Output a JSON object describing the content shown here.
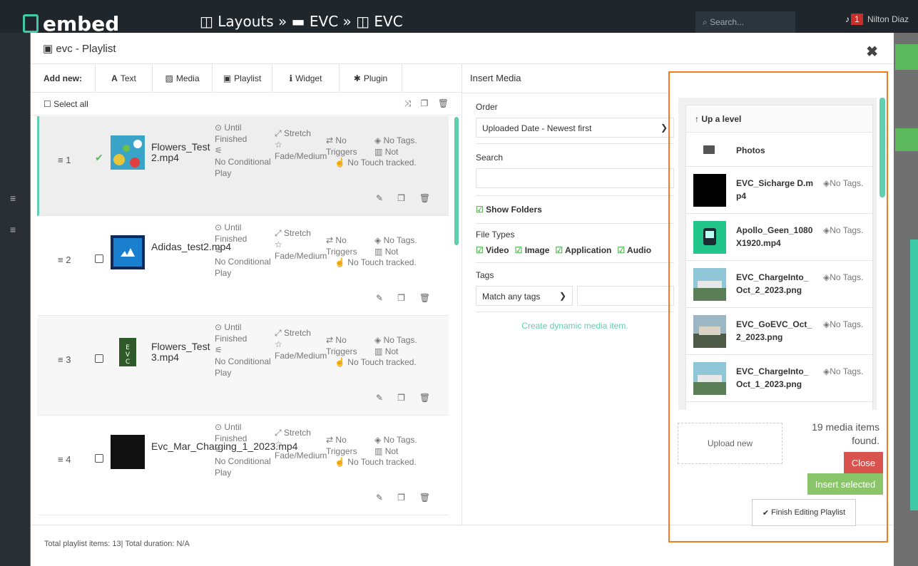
{
  "app": {
    "logo": "embed",
    "breadcrumb": [
      "Layouts",
      "EVC",
      "EVC"
    ],
    "search_placeholder": "Search...",
    "notification_count": "1",
    "user": "Nilton Diaz"
  },
  "modal": {
    "title": "evc - Playlist",
    "close_glyph": "✖"
  },
  "add_new": {
    "label": "Add new:",
    "buttons": [
      "Text",
      "Media",
      "Playlist",
      "Widget",
      "Plugin"
    ]
  },
  "toolbar": {
    "select_all": "Select all"
  },
  "playlist": [
    {
      "index": "1",
      "name": "Flowers_Test 2.mp4",
      "checked": true,
      "duration": "Until Finished",
      "condition": "No Conditional Play",
      "stretch": "Stretch",
      "transition": "Fade/Medium",
      "triggers": "No Triggers",
      "tags": "No Tags.",
      "tracking": "Not",
      "touch": "No Touch tracked."
    },
    {
      "index": "2",
      "name": "Adidas_test2.mp4",
      "checked": false,
      "duration": "Until Finished",
      "condition": "No Conditional Play",
      "stretch": "Stretch",
      "transition": "Fade/Medium",
      "triggers": "No Triggers",
      "tags": "No Tags.",
      "tracking": "Not",
      "touch": "No Touch tracked."
    },
    {
      "index": "3",
      "name": "Flowers_Test 3.mp4",
      "checked": false,
      "duration": "Until Finished",
      "condition": "No Conditional Play",
      "stretch": "Stretch",
      "transition": "Fade/Medium",
      "triggers": "No Triggers",
      "tags": "No Tags.",
      "tracking": "Not",
      "touch": "No Touch tracked."
    },
    {
      "index": "4",
      "name": "Evc_Mar_Charging_1_2023.mp4",
      "checked": false,
      "duration": "Until Finished",
      "condition": "No Conditional Play",
      "stretch": "Stretch",
      "transition": "Fade/Medium",
      "triggers": "No Triggers",
      "tags": "No Tags.",
      "tracking": "Not",
      "touch": "No Touch tracked."
    }
  ],
  "insert_media": {
    "title": "Insert Media",
    "order_label": "Order",
    "order_value": "Uploaded Date - Newest first",
    "search_label": "Search",
    "show_folders": "Show Folders",
    "file_types_label": "File Types",
    "file_types": [
      "Video",
      "Image",
      "Application",
      "Audio"
    ],
    "tags_label": "Tags",
    "tags_mode": "Match any tags",
    "create_dynamic": "Create dynamic media item."
  },
  "media_browser": {
    "up_level": "Up a level",
    "folder": "Photos",
    "items": [
      {
        "name": "EVC_Sicharge D.mp4",
        "tags": "No Tags."
      },
      {
        "name": "Apollo_Geen_1080X1920.mp4",
        "tags": "No Tags."
      },
      {
        "name": "EVC_ChargeInto_Oct_2_2023.png",
        "tags": "No Tags."
      },
      {
        "name": "EVC_GoEVC_Oct_2_2023.png",
        "tags": "No Tags."
      },
      {
        "name": "EVC_ChargeInto_Oct_1_2023.png",
        "tags": "No Tags."
      }
    ],
    "upload": "Upload new",
    "found": "19 media items found.",
    "close": "Close",
    "insert": "Insert selected"
  },
  "footer": {
    "summary": "Total playlist items: 13| Total duration: N/A",
    "finish": "Finish Editing Playlist"
  },
  "colors": {
    "accent": "#5fcfb0",
    "highlight": "#f07e20",
    "danger": "#d9534f",
    "success": "#8ac56a"
  }
}
